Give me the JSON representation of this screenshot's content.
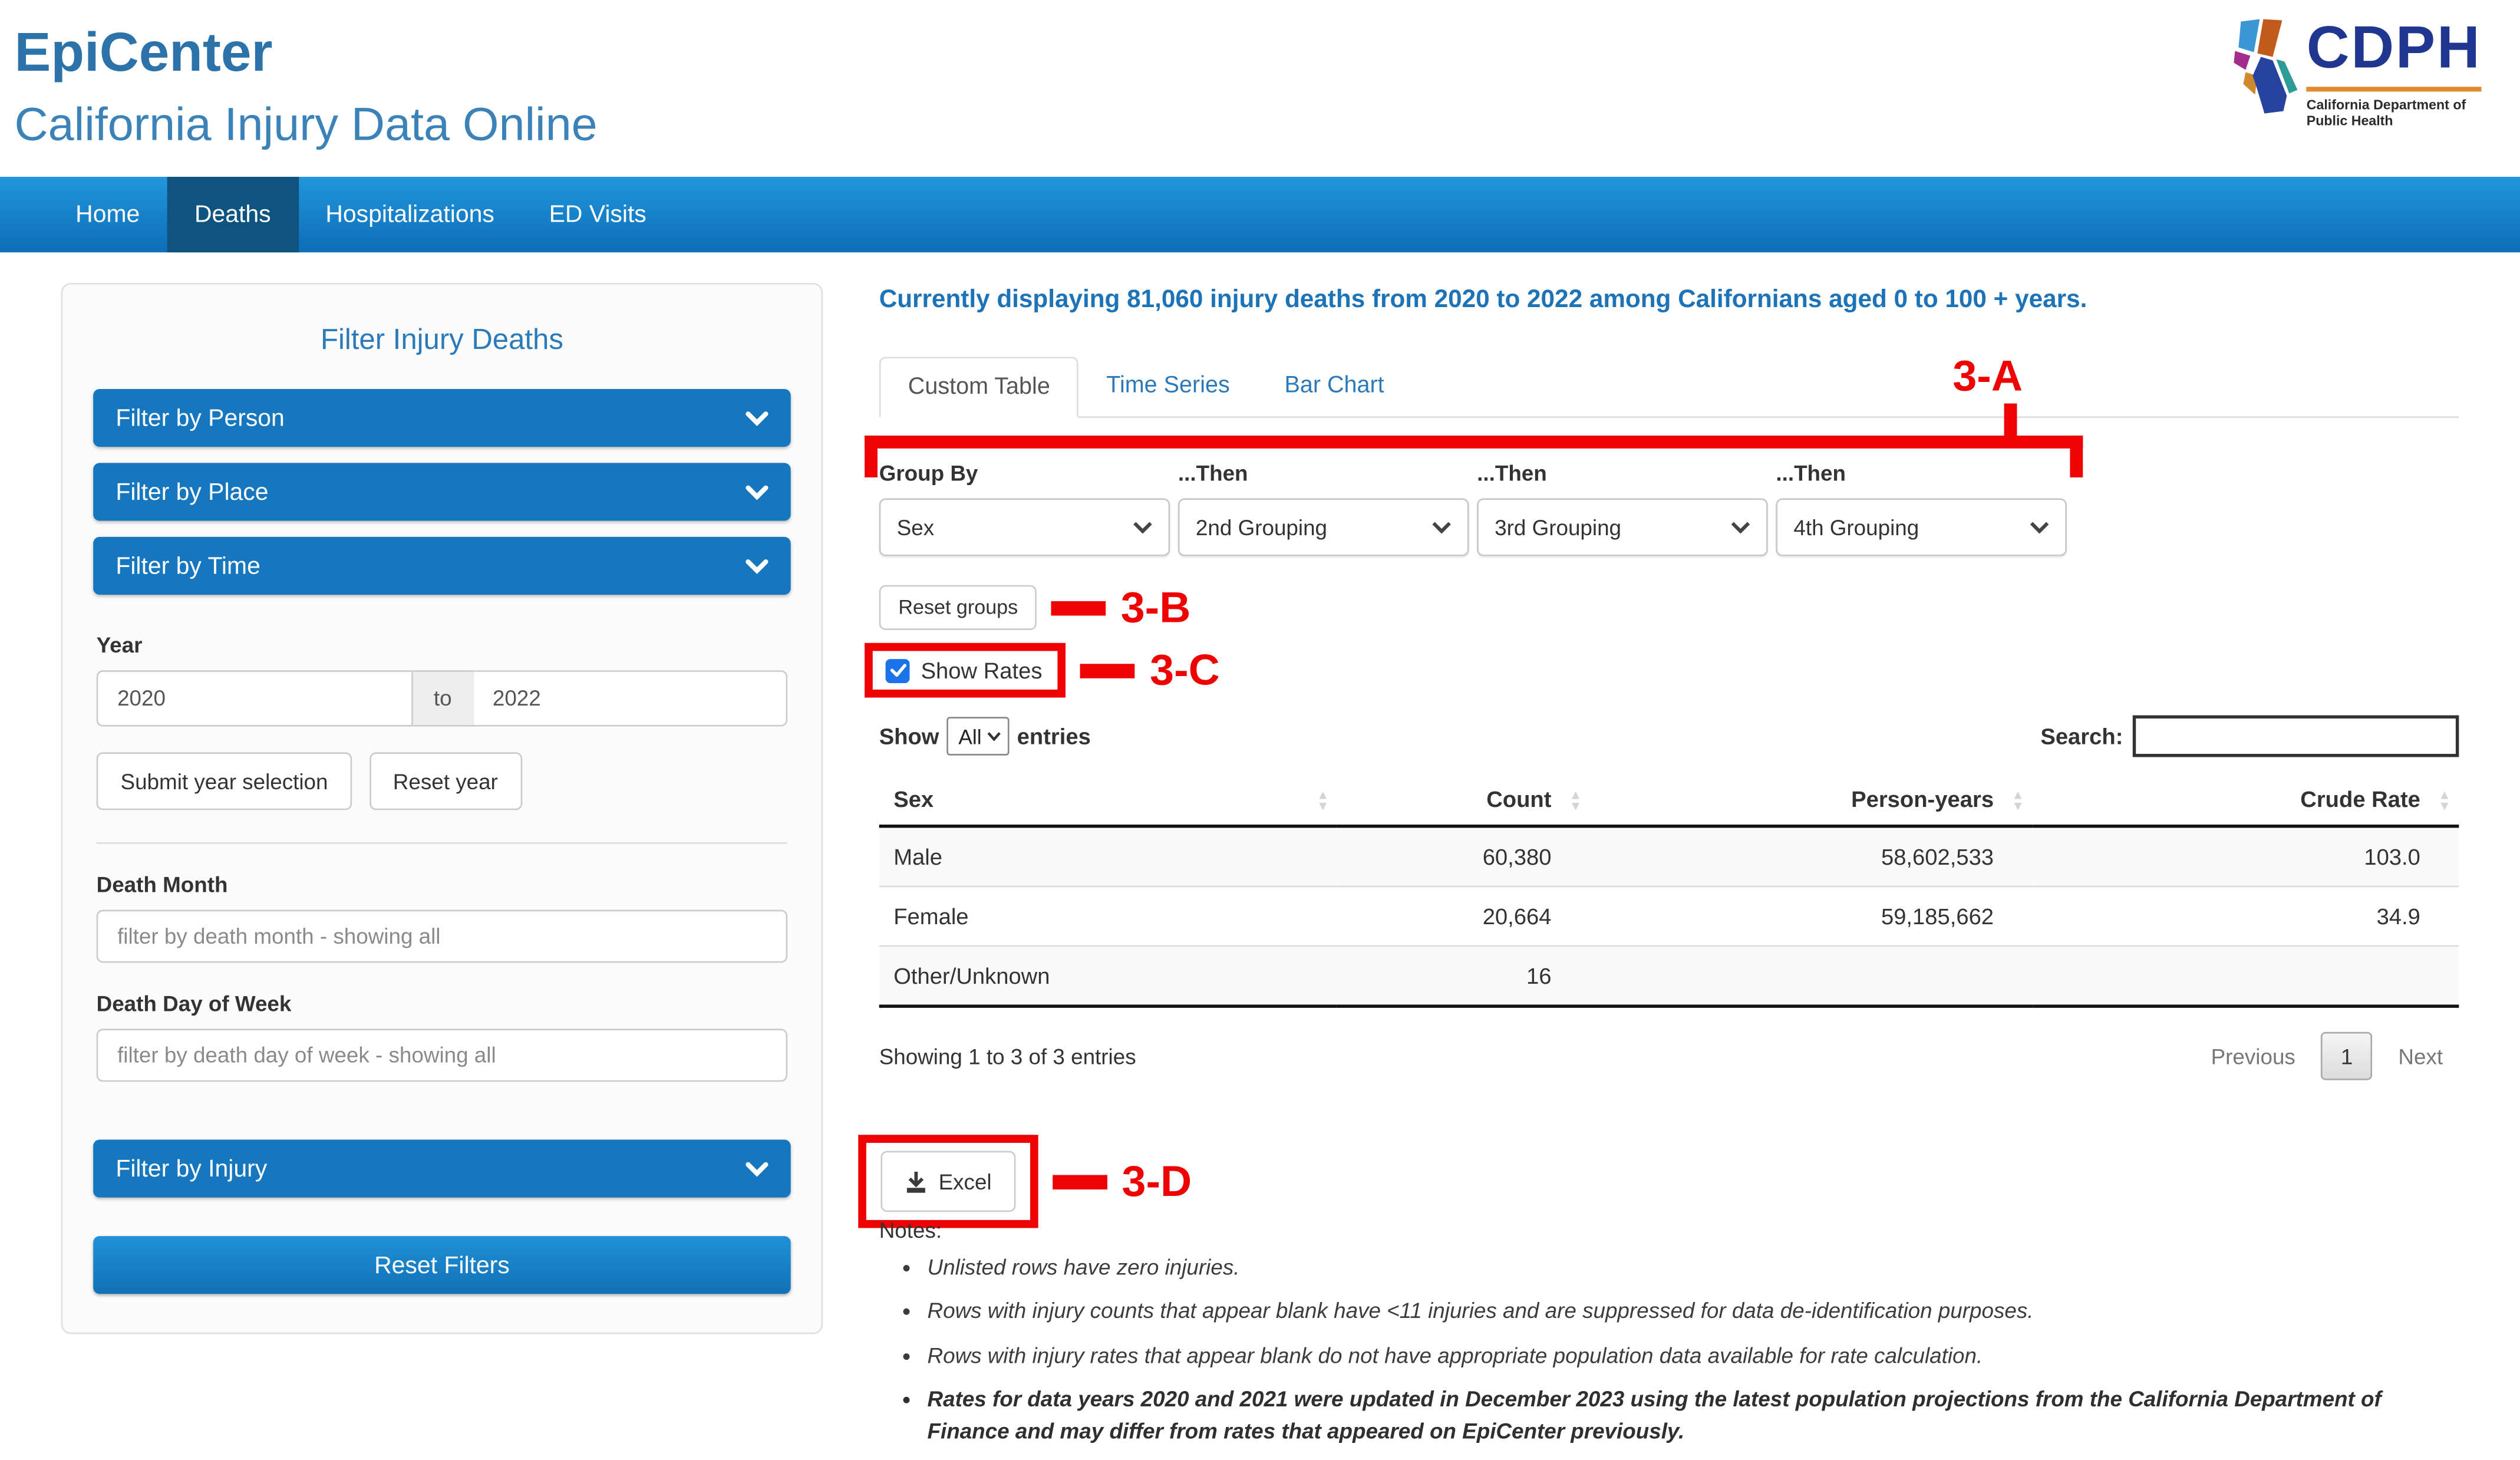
{
  "header": {
    "title": "EpiCenter",
    "subtitle": "California Injury Data Online",
    "logo": {
      "acronym": "CDPH",
      "caption_line1": "California Department of",
      "caption_line2": "Public Health"
    }
  },
  "nav": {
    "items": [
      {
        "label": "Home"
      },
      {
        "label": "Deaths"
      },
      {
        "label": "Hospitalizations"
      },
      {
        "label": "ED Visits"
      }
    ]
  },
  "filters": {
    "title": "Filter Injury Deaths",
    "accordions": [
      {
        "label": "Filter by Person"
      },
      {
        "label": "Filter by Place"
      },
      {
        "label": "Filter by Time"
      },
      {
        "label": "Filter by Injury"
      }
    ],
    "time": {
      "year_label": "Year",
      "year_from": "2020",
      "to_label": "to",
      "year_to": "2022",
      "submit_label": "Submit year selection",
      "reset_label": "Reset year",
      "death_month_label": "Death Month",
      "death_month_placeholder": "filter by death month - showing all",
      "death_dow_label": "Death Day of Week",
      "death_dow_placeholder": "filter by death day of week - showing all"
    },
    "reset_filters_label": "Reset Filters"
  },
  "main": {
    "summary": "Currently displaying 81,060 injury deaths from 2020 to 2022 among Californians aged 0 to 100 + years.",
    "tabs": [
      {
        "label": "Custom Table"
      },
      {
        "label": "Time Series"
      },
      {
        "label": "Bar Chart"
      }
    ],
    "grouping": {
      "labels": [
        "Group By",
        "...Then",
        "...Then",
        "...Then"
      ],
      "selects": [
        "Sex",
        "2nd Grouping",
        "3rd Grouping",
        "4th Grouping"
      ],
      "reset_groups_label": "Reset groups",
      "show_rates_label": "Show Rates",
      "show_rates_checked": true
    },
    "table_controls": {
      "show_label": "Show",
      "entries_value": "All",
      "entries_label": "entries",
      "search_label": "Search:"
    },
    "table": {
      "columns": [
        "Sex",
        "Count",
        "Person-years",
        "Crude Rate"
      ],
      "rows": [
        {
          "sex": "Male",
          "count": "60,380",
          "person_years": "58,602,533",
          "crude_rate": "103.0"
        },
        {
          "sex": "Female",
          "count": "20,664",
          "person_years": "59,185,662",
          "crude_rate": "34.9"
        },
        {
          "sex": "Other/Unknown",
          "count": "16",
          "person_years": "",
          "crude_rate": ""
        }
      ]
    },
    "pagination": {
      "info": "Showing 1 to 3 of 3 entries",
      "previous": "Previous",
      "page": "1",
      "next": "Next"
    },
    "export": {
      "excel_label": "Excel"
    },
    "notes": {
      "heading": "Notes:",
      "items": [
        {
          "text": "Unlisted rows have zero injuries."
        },
        {
          "text": "Rows with injury counts that appear blank have <11 injuries and are suppressed for data de-identification purposes."
        },
        {
          "text": "Rows with injury rates that appear blank do not have appropriate population data available for rate calculation."
        },
        {
          "text": "Rates for data years 2020 and 2021 were updated in December 2023 using the latest population projections from the California Department of Finance and may differ from rates that appeared on EpiCenter previously."
        }
      ]
    },
    "annotations": {
      "a": "3-A",
      "b": "3-B",
      "c": "3-C",
      "d": "3-D",
      "color": "#ee0202"
    }
  },
  "icons": {
    "sort_asc": "▲",
    "sort_desc": "▼"
  }
}
